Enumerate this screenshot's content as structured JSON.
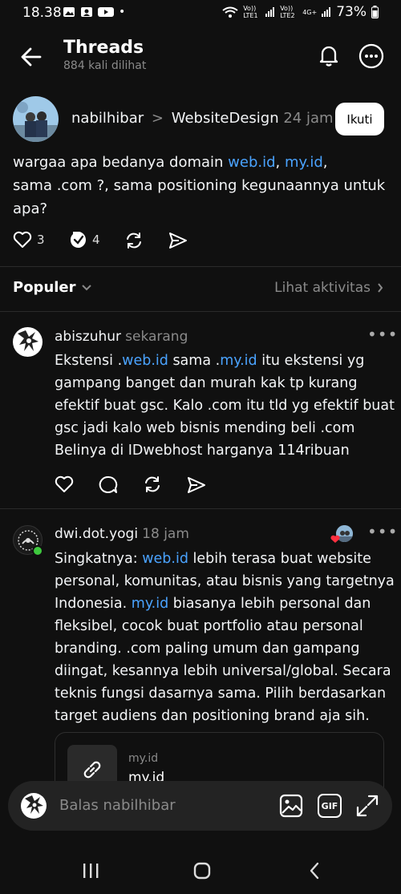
{
  "status": {
    "time": "18.38",
    "lte1": "Vo)) LTE1",
    "lte2": "Vo)) LTE2",
    "net": "4G+",
    "battery": "73%"
  },
  "header": {
    "title": "Threads",
    "subtitle": "884 kali dilihat"
  },
  "post": {
    "username": "nabilhibar",
    "separator": ">",
    "community": "WebsiteDesign",
    "time": "24 jam",
    "follow_label": "Ikuti",
    "text": {
      "p1": "wargaa apa bedanya domain ",
      "l1": "web.id",
      "p2": ", ",
      "l2": "my.id",
      "p3": ",",
      "line2": "sama .com ?, sama positioning kegunaannya untuk",
      "line3": "apa?"
    },
    "likes": "3",
    "reposts": "4"
  },
  "section": {
    "sort_label": "Populer",
    "activity_label": "Lihat aktivitas"
  },
  "comments": [
    {
      "username": "abiszuhur",
      "time": "sekarang",
      "l1a": "Ekstensi .",
      "l1b": "web.id",
      "l1c": " sama .",
      "l1d": "my.id",
      "l1e": " itu ekstensi yg",
      "l2": "gampang banget dan murah kak tp kurang",
      "l3": "efektif buat gsc. Kalo .com itu tld yg efektif buat",
      "l4": "gsc jadi kalo web bisnis mending beli .com",
      "l5": "Belinya di IDwebhost harganya 114ribuan"
    },
    {
      "username": "dwi.dot.yogi",
      "time": "18 jam",
      "l1a": "Singkatnya: ",
      "l1b": "web.id",
      "l1c": " lebih terasa buat website",
      "l2": "personal, komunitas, atau bisnis yang targetnya",
      "l3a": "Indonesia. ",
      "l3b": "my.id",
      "l3c": " biasanya lebih personal dan",
      "l4": "fleksibel, cocok buat portfolio atau personal",
      "l5": "branding. .com paling umum dan gampang",
      "l6": "diingat, kesannya lebih universal/global. Secara",
      "l7": "teknis fungsi dasarnya sama. Pilih berdasarkan",
      "l8": "target audiens dan positioning brand aja sih.",
      "card_small": "my.id",
      "card_title": "my.id"
    }
  ],
  "reply": {
    "placeholder": "Balas nabilhibar",
    "gif_label": "GIF"
  },
  "colors": {
    "background": "#101010",
    "link": "#4aa3ff",
    "muted": "#8a8a8a",
    "online": "#3ec93e"
  }
}
